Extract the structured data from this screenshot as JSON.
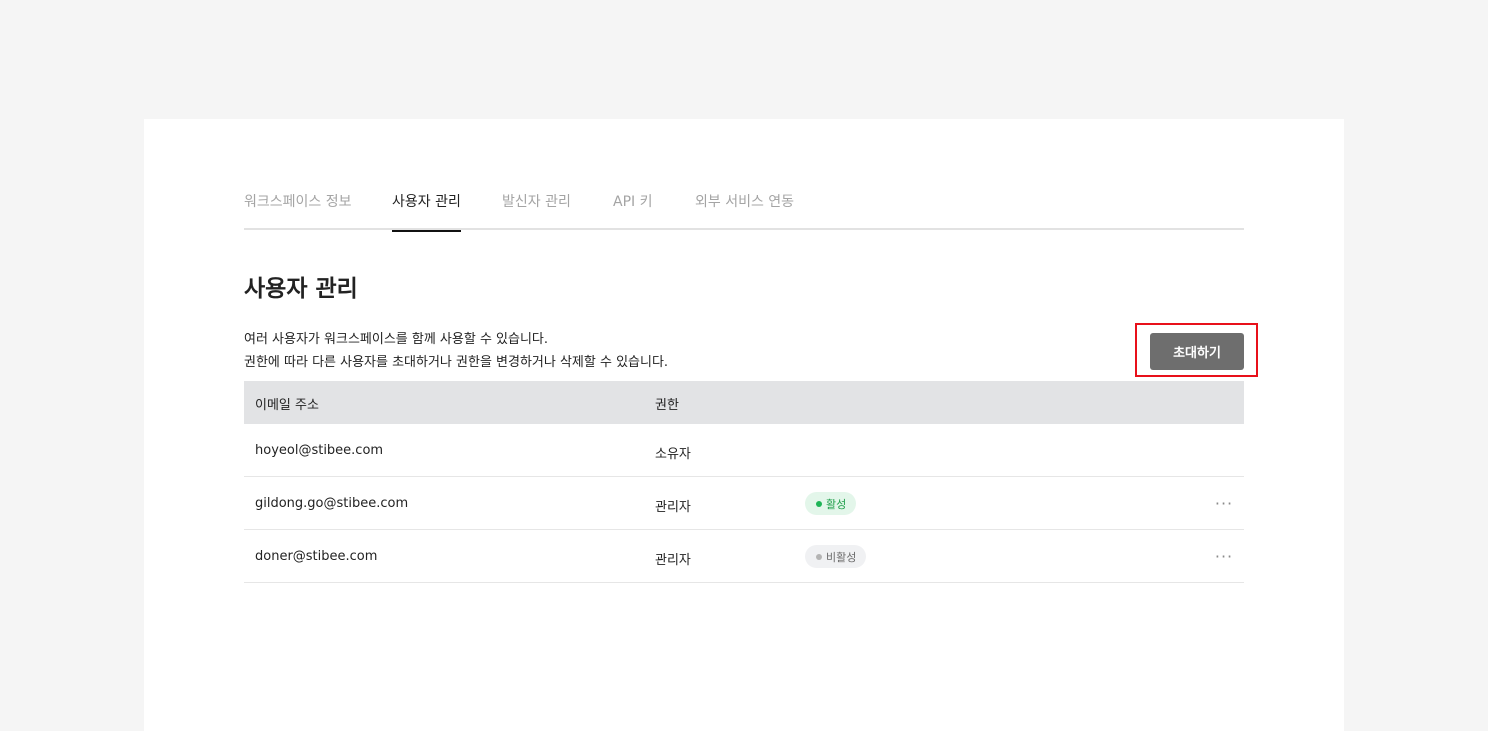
{
  "tabs": [
    {
      "label": "워크스페이스 정보",
      "active": false
    },
    {
      "label": "사용자 관리",
      "active": true
    },
    {
      "label": "발신자 관리",
      "active": false
    },
    {
      "label": "API 키",
      "active": false
    },
    {
      "label": "외부 서비스 연동",
      "active": false
    }
  ],
  "page": {
    "title": "사용자 관리",
    "description_line1": "여러 사용자가 워크스페이스를 함께 사용할 수 있습니다.",
    "description_line2": "권한에 따라 다른 사용자를 초대하거나 권한을 변경하거나 삭제할 수 있습니다.",
    "invite_label": "초대하기"
  },
  "table": {
    "columns": [
      "이메일 주소",
      "권한"
    ],
    "rows": [
      {
        "email": "hoyeol@stibee.com",
        "role": "소유자",
        "status": "",
        "status_type": "none",
        "has_menu": false
      },
      {
        "email": "gildong.go@stibee.com",
        "role": "관리자",
        "status": "활성",
        "status_type": "active",
        "has_menu": true
      },
      {
        "email": "doner@stibee.com",
        "role": "관리자",
        "status": "비활성",
        "status_type": "inactive",
        "has_menu": true
      }
    ],
    "menu_glyph": "···"
  },
  "colors": {
    "page_background": "#f5f5f5",
    "invite_button": "#6e6e6e",
    "highlight_border": "#e8101a",
    "active_badge": "#1fb457",
    "inactive_badge": "#b4b4b4"
  }
}
